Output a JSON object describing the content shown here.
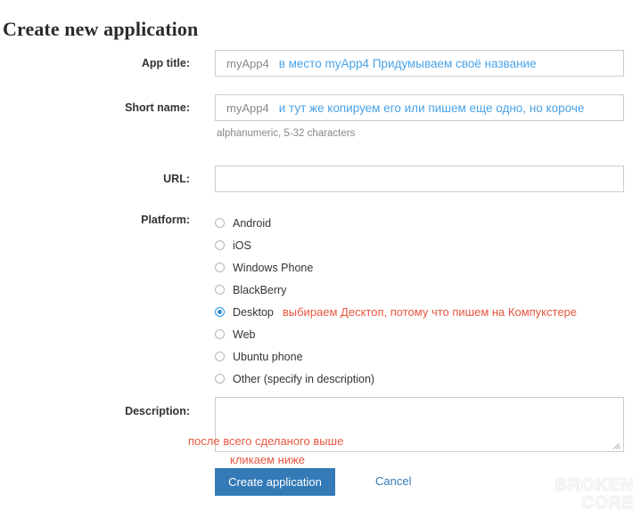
{
  "page": {
    "title": "Create new application"
  },
  "fields": {
    "app_title": {
      "label": "App title:",
      "value": "",
      "placeholder": "myApp4",
      "annotation": "в место myApp4 Придумываем своё название"
    },
    "short_name": {
      "label": "Short name:",
      "value": "",
      "placeholder": "myApp4",
      "annotation": "и тут же копируем его или пишем еще одно, но короче",
      "hint": "alphanumeric, 5-32 characters"
    },
    "url": {
      "label": "URL:",
      "value": "",
      "placeholder": ""
    },
    "platform": {
      "label": "Platform:",
      "selected": "Desktop",
      "annotation": "выбираем Десктоп, потому что пишем на Компукстере",
      "options": [
        {
          "label": "Android",
          "selected": false
        },
        {
          "label": "iOS",
          "selected": false
        },
        {
          "label": "Windows Phone",
          "selected": false
        },
        {
          "label": "BlackBerry",
          "selected": false
        },
        {
          "label": "Desktop",
          "selected": true
        },
        {
          "label": "Web",
          "selected": false
        },
        {
          "label": "Ubuntu phone",
          "selected": false
        },
        {
          "label": "Other (specify in description)",
          "selected": false
        }
      ]
    },
    "description": {
      "label": "Description:",
      "value": "",
      "placeholder": ""
    }
  },
  "annotations": {
    "after_all_above": "после всего сделаного выше",
    "click_below": "кликаем ниже"
  },
  "actions": {
    "submit_label": "Create application",
    "cancel_label": "Cancel"
  },
  "watermark": {
    "line1": "BROKEN",
    "line2": "CORE"
  },
  "colors": {
    "primary_button": "#337ab7",
    "link": "#337ab7",
    "annotation_blue": "#4aa3e8",
    "annotation_red": "#e8563f",
    "radio_selected": "#2b8fd8",
    "input_border": "#cccccc",
    "hint_text": "#888888"
  }
}
